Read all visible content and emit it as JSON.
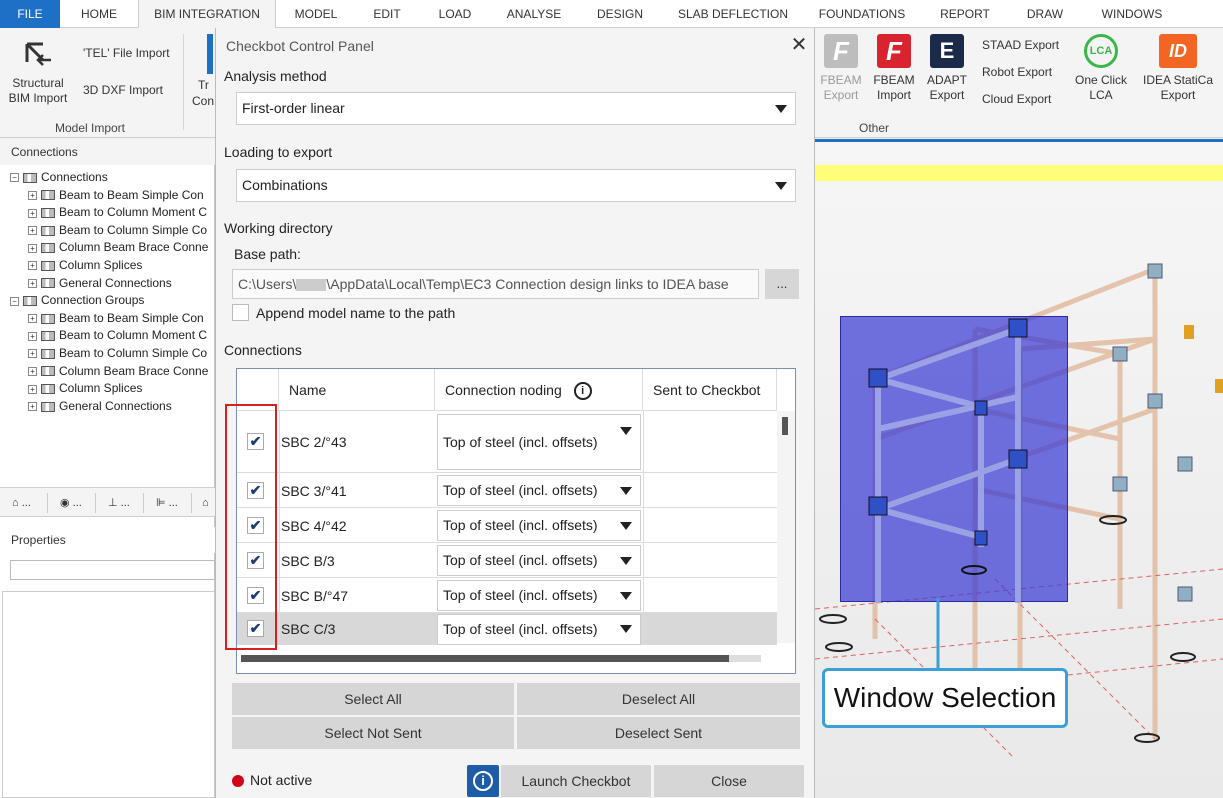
{
  "menu": {
    "items": [
      "FILE",
      "HOME",
      "BIM INTEGRATION",
      "MODEL",
      "EDIT",
      "LOAD",
      "ANALYSE",
      "DESIGN",
      "SLAB DEFLECTION",
      "FOUNDATIONS",
      "REPORT",
      "DRAW",
      "WINDOWS"
    ],
    "active": "BIM INTEGRATION"
  },
  "ribbon": {
    "structural_bim_import_1": "Structural",
    "structural_bim_import_2": "BIM Import",
    "tel_import": "'TEL' File Import",
    "dxf_import": "3D DXF Import",
    "partial_tr": "Tr",
    "partial_con": "Con",
    "group_model_import": "Model Import",
    "fbeam_export_1": "FBEAM",
    "fbeam_export_2": "Export",
    "fbeam_import_1": "FBEAM",
    "fbeam_import_2": "Import",
    "adapt_export_1": "ADAPT",
    "adapt_export_2": "Export",
    "staad_export": "STAAD Export",
    "robot_export": "Robot Export",
    "cloud_export": "Cloud Export",
    "one_click_lca_1": "One Click",
    "one_click_lca_2": "LCA",
    "lca_logo": "LCA",
    "idea_export_1": "IDEA StatiCa",
    "idea_export_2": "Export",
    "idea_logo": "ID",
    "fbeam_logo": "F",
    "adapt_logo": "E",
    "group_other": "Other"
  },
  "left_panel": {
    "connections_header": "Connections",
    "properties_header": "Properties",
    "tree": [
      {
        "label": "Connections",
        "level": 0
      },
      {
        "label": "Beam to Beam Simple Con",
        "level": 1
      },
      {
        "label": "Beam to Column Moment C",
        "level": 1
      },
      {
        "label": "Beam to Column Simple Co",
        "level": 1
      },
      {
        "label": "Column Beam Brace Conne",
        "level": 1
      },
      {
        "label": "Column Splices",
        "level": 1
      },
      {
        "label": "General Connections",
        "level": 1
      },
      {
        "label": "Connection Groups",
        "level": 0
      },
      {
        "label": "Beam to Beam Simple Con",
        "level": 1
      },
      {
        "label": "Beam to Column Moment C",
        "level": 1
      },
      {
        "label": "Beam to Column Simple Co",
        "level": 1
      },
      {
        "label": "Column Beam Brace Conne",
        "level": 1
      },
      {
        "label": "Column Splices",
        "level": 1
      },
      {
        "label": "General Connections",
        "level": 1
      }
    ],
    "tools": [
      "...",
      "...",
      "...",
      "..."
    ]
  },
  "dialog": {
    "title": "Checkbot Control Panel",
    "close_glyph": "✕",
    "analysis_method_label": "Analysis method",
    "analysis_method_value": "First-order linear",
    "loading_label": "Loading to export",
    "loading_value": "Combinations",
    "workdir_label": "Working directory",
    "base_path_label": "Base path:",
    "base_path_prefix": "C:\\Users\\",
    "base_path_suffix": "\\AppData\\Local\\Temp\\EC3 Connection design links to IDEA base",
    "browse_label": "...",
    "append_label": "Append model name to the path",
    "connections_label": "Connections",
    "table": {
      "headers": [
        "Name",
        "Connection noding",
        "Sent to Checkbot"
      ],
      "info_glyph": "i",
      "rows": [
        {
          "name": "SBC 2/°43",
          "noding": "Top of steel (incl. offsets)",
          "checked": true,
          "check_glyph": "✔"
        },
        {
          "name": "SBC 3/°41",
          "noding": "Top of steel (incl. offsets)",
          "checked": true,
          "check_glyph": "✔"
        },
        {
          "name": "SBC 4/°42",
          "noding": "Top of steel (incl. offsets)",
          "checked": true,
          "check_glyph": "✔"
        },
        {
          "name": "SBC B/3",
          "noding": "Top of steel (incl. offsets)",
          "checked": true,
          "check_glyph": "✔"
        },
        {
          "name": "SBC B/°47",
          "noding": "Top of steel (incl. offsets)",
          "checked": true,
          "check_glyph": "✔"
        },
        {
          "name": "SBC C/3",
          "noding": "Top of steel (incl. offsets)",
          "checked": true,
          "check_glyph": "✔"
        }
      ]
    },
    "select_all": "Select All",
    "deselect_all": "Deselect All",
    "select_not_sent": "Select Not Sent",
    "deselect_sent": "Deselect Sent",
    "status": "Not active",
    "info_glyph": "i",
    "launch": "Launch Checkbot",
    "close": "Close"
  },
  "viewport": {
    "callout": "Window Selection"
  },
  "colors": {
    "accent": "#1e6fc6",
    "status_inactive": "#d0021b",
    "highlight": "#d62020"
  }
}
